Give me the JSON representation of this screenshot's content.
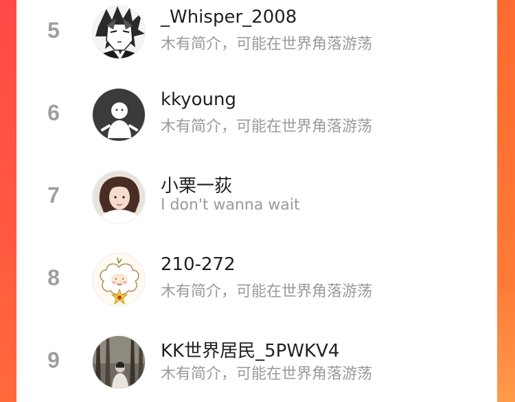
{
  "colors": {
    "accent_left": "#ff4a48",
    "accent_right": "#ff7a36",
    "rank_color": "#9e9e9e",
    "name_color": "#1f1f1f",
    "bio_color": "#9a9a9a"
  },
  "users": [
    {
      "rank": "5",
      "name": "_Whisper_2008",
      "bio": "木有简介，可能在世界角落游荡",
      "avatar_icon": "anime-character-avatar"
    },
    {
      "rank": "6",
      "name": "kkyoung",
      "bio": "木有简介，可能在世界角落游荡",
      "avatar_icon": "default-ghost-avatar"
    },
    {
      "rank": "7",
      "name": "小栗一荻",
      "bio": "I don't wanna wait",
      "avatar_icon": "girl-portrait-avatar"
    },
    {
      "rank": "8",
      "name": "210-272",
      "bio": "木有简介，可能在世界角落游荡",
      "avatar_icon": "cartoon-sheep-avatar"
    },
    {
      "rank": "9",
      "name": "KK世界居民_5PWKV4",
      "bio": "木有简介，可能在世界角落游荡",
      "avatar_icon": "forest-photo-avatar"
    }
  ]
}
